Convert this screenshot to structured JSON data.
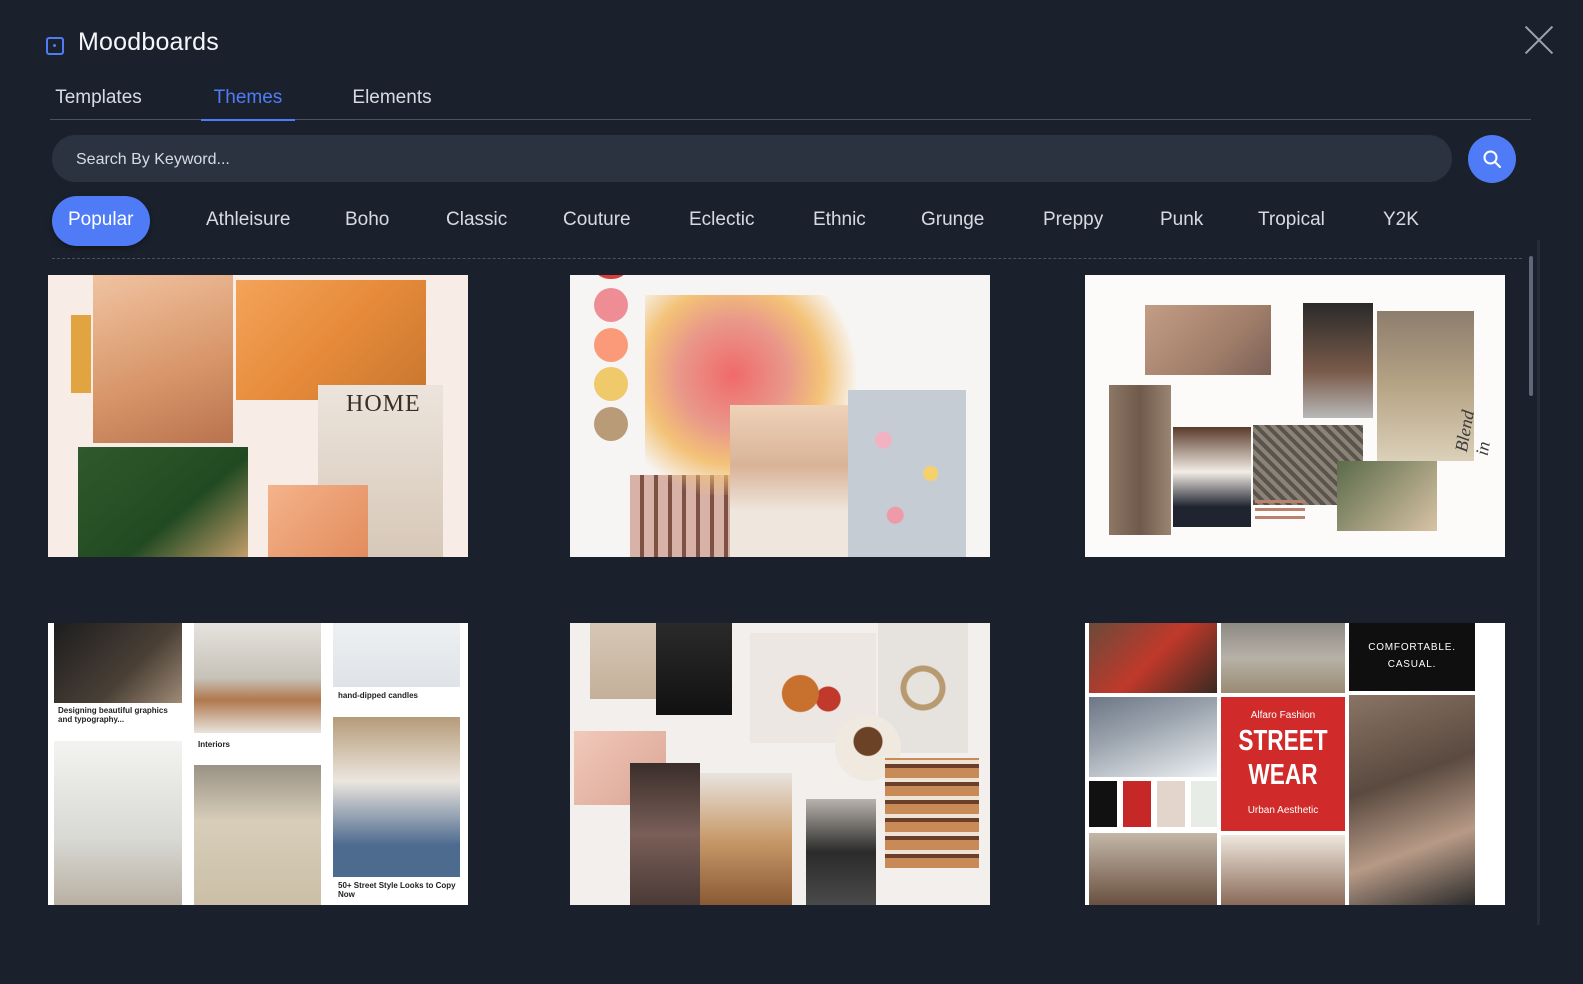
{
  "app": {
    "title": "Moodboards"
  },
  "tabs": [
    "Templates",
    "Themes",
    "Elements"
  ],
  "active_tab": "Themes",
  "search": {
    "placeholder": "Search By Keyword..."
  },
  "categories": [
    "Popular",
    "Athleisure",
    "Boho",
    "Classic",
    "Couture",
    "Eclectic",
    "Ethnic",
    "Grunge",
    "Preppy",
    "Punk",
    "Tropical",
    "Y2K"
  ],
  "active_category": "Popular",
  "colors": {
    "accent": "#4f7cf6",
    "background": "#1b212c",
    "search_bg": "#2b3340"
  },
  "cards": [
    {
      "theme": "warm-home",
      "home_text": "HOME"
    },
    {
      "theme": "floral"
    },
    {
      "theme": "beige-knit",
      "side_text": "Blend in"
    },
    {
      "theme": "interiors",
      "captions": {
        "graphics": "Designing beautiful graphics and typography...",
        "interiors": "Interiors",
        "candles": "hand-dipped candles",
        "street": "50+ Street Style Looks to Copy Now"
      }
    },
    {
      "theme": "autumn-knit"
    },
    {
      "theme": "streetwear",
      "comfortable": "COMFORTABLE. CASUAL.",
      "brand": "Alfaro Fashion",
      "headline1": "STREET",
      "headline2": "WEAR",
      "subtitle": "Urban Aesthetic"
    }
  ]
}
